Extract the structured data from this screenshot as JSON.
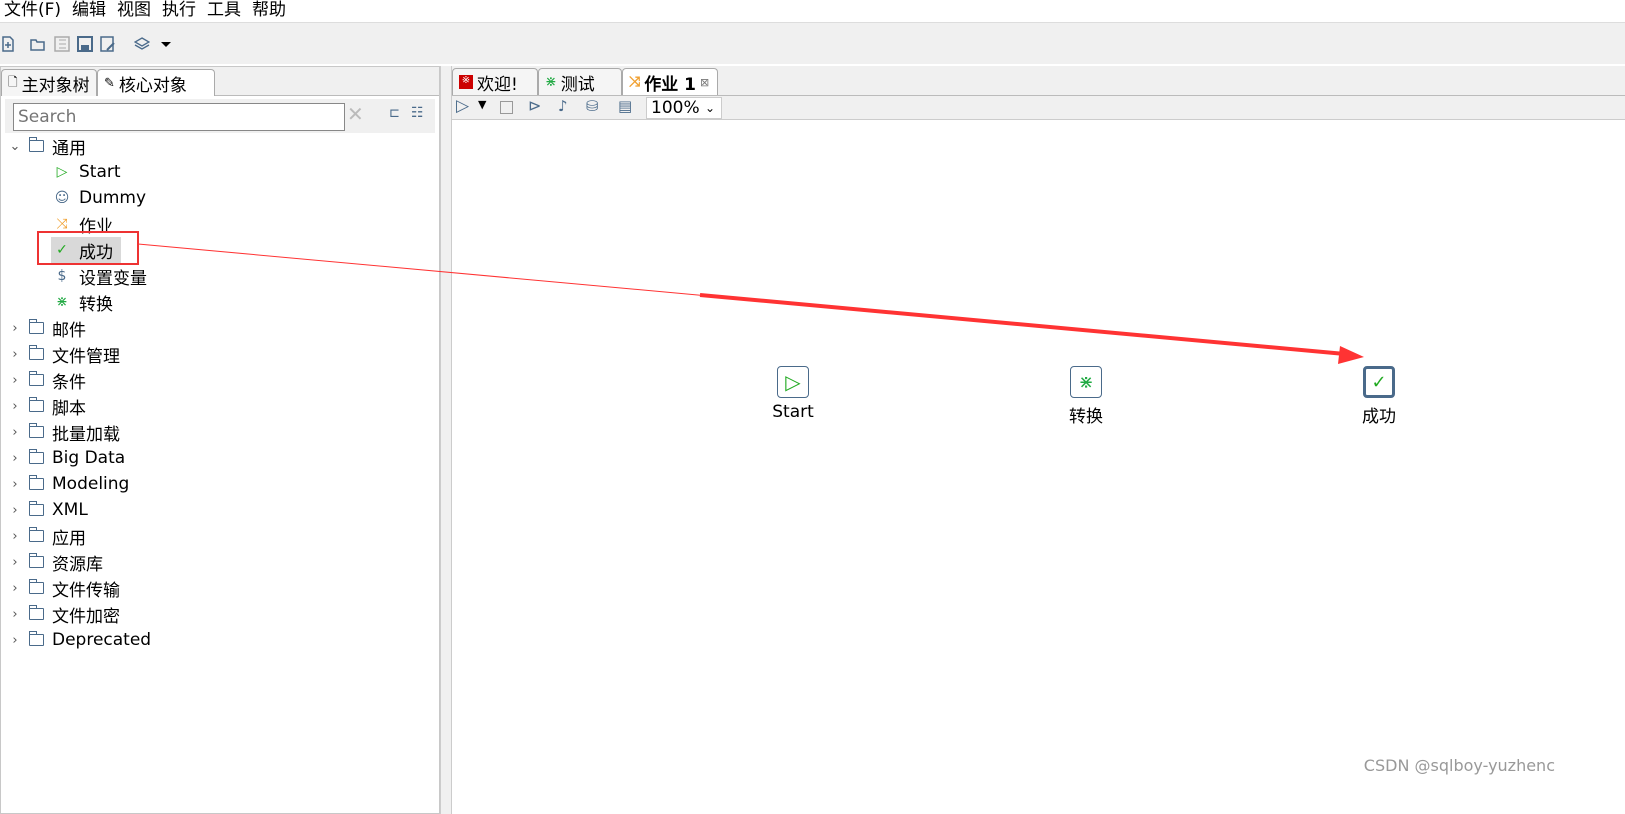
{
  "menu": [
    "文件(F)",
    "编辑",
    "视图",
    "执行",
    "工具",
    "帮助"
  ],
  "left_tabs": [
    "主对象树",
    "核心对象"
  ],
  "search": {
    "placeholder": "Search"
  },
  "tree": {
    "expanded_folder": "通用",
    "children": [
      {
        "label": "Start",
        "icon": "start-triangle-icon",
        "color": "#22aa22"
      },
      {
        "label": "Dummy",
        "icon": "head-icon",
        "color": "#4a6a8a"
      },
      {
        "label": "作业",
        "icon": "job-arrows-icon",
        "color": "#f0a030"
      },
      {
        "label": "成功",
        "icon": "checkmark-icon",
        "color": "#22aa22",
        "selected": true
      },
      {
        "label": "设置变量",
        "icon": "set-variable-icon",
        "color": "#4a6a8a"
      },
      {
        "label": "转换",
        "icon": "transformation-icon",
        "color": "#22aa44"
      }
    ],
    "folders": [
      "邮件",
      "文件管理",
      "条件",
      "脚本",
      "批量加载",
      "Big Data",
      "Modeling",
      "XML",
      "应用",
      "资源库",
      "文件传输",
      "文件加密",
      "Deprecated"
    ]
  },
  "right_tabs": [
    {
      "label": "欢迎!"
    },
    {
      "label": "测试"
    },
    {
      "label": "作业 1",
      "active": true
    }
  ],
  "zoom": "100%",
  "canvas_nodes": [
    {
      "label": "Start"
    },
    {
      "label": "转换"
    },
    {
      "label": "成功"
    }
  ],
  "annotation_color": "#ff3333",
  "watermark": "CSDN @sqlboy-yuzhenc"
}
